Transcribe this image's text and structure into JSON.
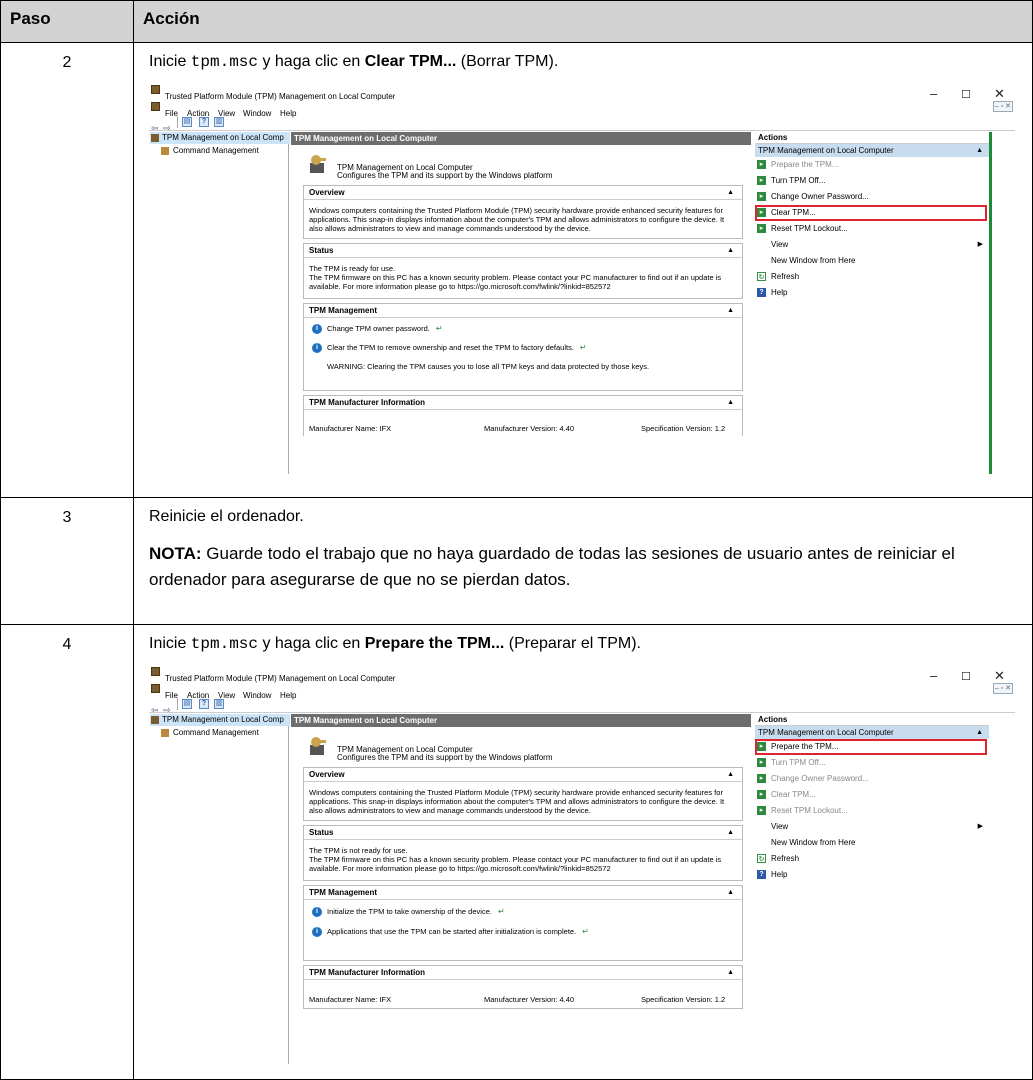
{
  "table": {
    "col_step": "Paso",
    "col_action": "Acción"
  },
  "step2": {
    "num": "2",
    "pre": "Inicie ",
    "code": "tpm.msc",
    "mid": " y haga clic en ",
    "bold": "Clear TPM...",
    "post": " (Borrar TPM)."
  },
  "step3": {
    "num": "3",
    "text": "Reinicie el ordenador.",
    "nota_label": "NOTA:",
    "nota_text": " Guarde todo el trabajo que no haya guardado de todas las sesiones de usuario antes de reiniciar el ordenador para asegurarse de que no se pierdan datos."
  },
  "step4": {
    "num": "4",
    "pre": "Inicie ",
    "code": "tpm.msc",
    "mid": " y haga clic en ",
    "bold": "Prepare the TPM...",
    "post": " (Preparar el TPM)."
  },
  "mmc": {
    "title": "Trusted Platform Module (TPM) Management on Local Computer",
    "menu": [
      "File",
      "Action",
      "View",
      "Window",
      "Help"
    ],
    "tree_root": "TPM Management on Local Comp",
    "tree_child": "Command Management",
    "center_head": "TPM Management on Local Computer",
    "intro_l1": "TPM Management on Local Computer",
    "intro_l2": "Configures the TPM and its support by the Windows platform",
    "overview_head": "Overview",
    "overview_body": "Windows computers containing the Trusted Platform Module (TPM) security hardware provide enhanced security features for applications. This snap-in displays information about the computer's TPM and allows administrators to configure the device. It also allows administrators to view and manage commands understood by the device.",
    "status_head": "Status",
    "tpm_mgmt_head": "TPM Management",
    "mfr_head": "TPM Manufacturer Information",
    "mfr_name": "Manufacturer Name:  IFX",
    "mfr_version": "Manufacturer Version:  4.40",
    "spec_version": "Specification Version:  1.2",
    "actions_head": "Actions",
    "actions_sub": "TPM Management on Local Computer",
    "act_prepare": "Prepare the TPM...",
    "act_turnoff": "Turn TPM Off...",
    "act_change": "Change Owner Password...",
    "act_clear": "Clear TPM...",
    "act_reset": "Reset TPM Lockout...",
    "act_view": "View",
    "act_newwin": "New Window from Here",
    "act_refresh": "Refresh",
    "act_help": "Help"
  },
  "shot1": {
    "status_l1": "The TPM is ready for use.",
    "status_l2": "The TPM firmware on this PC has a known security problem. Please contact your PC manufacturer to find out if an update is available. For more information please go to https://go.microsoft.com/fwlink/?linkid=852572",
    "mgmt_l1": "Change TPM owner password.",
    "mgmt_l2": "Clear the TPM to remove ownership and reset the TPM to factory defaults.",
    "mgmt_l3": "WARNING: Clearing the TPM causes you to lose all TPM keys and data protected by those keys."
  },
  "shot2": {
    "status_l1": "The TPM is not ready for use.",
    "status_l2": "The TPM firmware on this PC has a known security problem. Please contact your PC manufacturer to find out if an update is available. For more information please go to https://go.microsoft.com/fwlink/?linkid=852572",
    "mgmt_l1": "Initialize the TPM to take ownership of the device.",
    "mgmt_l2": "Applications that use the TPM can be started after initialization is complete."
  },
  "colors": {
    "highlight": "#e0242f",
    "header_bg": "#d3d3d3",
    "action_green": "#2e8b3e"
  }
}
